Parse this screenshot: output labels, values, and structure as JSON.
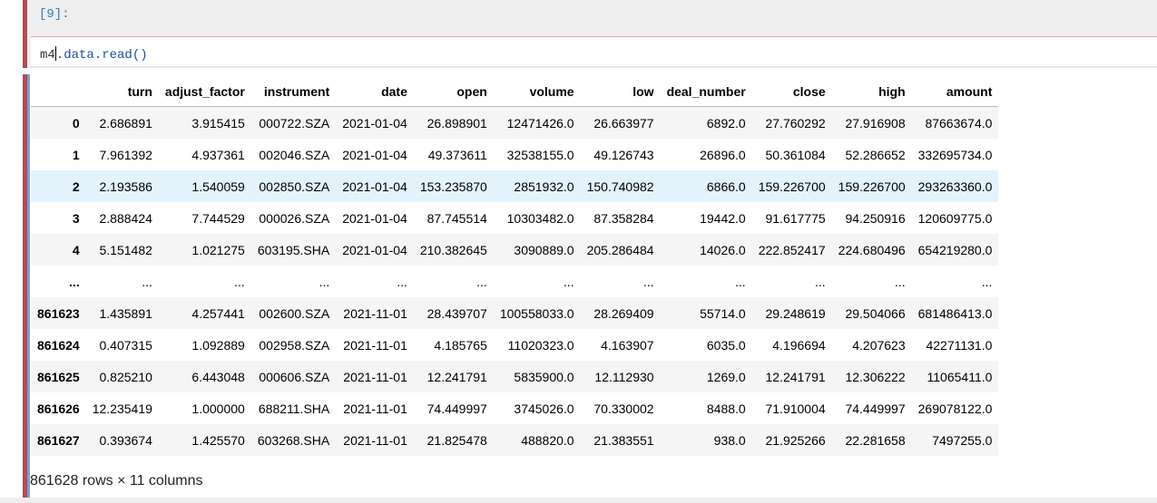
{
  "input_cell": {
    "prompt": "[9]:",
    "code_obj": "m4",
    "code_rest": ".data.read()"
  },
  "output": {
    "columns": [
      "turn",
      "adjust_factor",
      "instrument",
      "date",
      "open",
      "volume",
      "low",
      "deal_number",
      "close",
      "high",
      "amount"
    ],
    "rows": [
      {
        "index": "0",
        "cells": [
          "2.686891",
          "3.915415",
          "000722.SZA",
          "2021-01-04",
          "26.898901",
          "12471426.0",
          "26.663977",
          "6892.0",
          "27.760292",
          "27.916908",
          "87663674.0"
        ]
      },
      {
        "index": "1",
        "cells": [
          "7.961392",
          "4.937361",
          "002046.SZA",
          "2021-01-04",
          "49.373611",
          "32538155.0",
          "49.126743",
          "26896.0",
          "50.361084",
          "52.286652",
          "332695734.0"
        ]
      },
      {
        "index": "2",
        "cells": [
          "2.193586",
          "1.540059",
          "002850.SZA",
          "2021-01-04",
          "153.235870",
          "2851932.0",
          "150.740982",
          "6866.0",
          "159.226700",
          "159.226700",
          "293263360.0"
        ]
      },
      {
        "index": "3",
        "cells": [
          "2.888424",
          "7.744529",
          "000026.SZA",
          "2021-01-04",
          "87.745514",
          "10303482.0",
          "87.358284",
          "19442.0",
          "91.617775",
          "94.250916",
          "120609775.0"
        ]
      },
      {
        "index": "4",
        "cells": [
          "5.151482",
          "1.021275",
          "603195.SHA",
          "2021-01-04",
          "210.382645",
          "3090889.0",
          "205.286484",
          "14026.0",
          "222.852417",
          "224.680496",
          "654219280.0"
        ]
      },
      {
        "index": "...",
        "cells": [
          "...",
          "...",
          "...",
          "...",
          "...",
          "...",
          "...",
          "...",
          "...",
          "...",
          "..."
        ]
      },
      {
        "index": "861623",
        "cells": [
          "1.435891",
          "4.257441",
          "002600.SZA",
          "2021-11-01",
          "28.439707",
          "100558033.0",
          "28.269409",
          "55714.0",
          "29.248619",
          "29.504066",
          "681486413.0"
        ]
      },
      {
        "index": "861624",
        "cells": [
          "0.407315",
          "1.092889",
          "002958.SZA",
          "2021-11-01",
          "4.185765",
          "11020323.0",
          "4.163907",
          "6035.0",
          "4.196694",
          "4.207623",
          "42271131.0"
        ]
      },
      {
        "index": "861625",
        "cells": [
          "0.825210",
          "6.443048",
          "000606.SZA",
          "2021-11-01",
          "12.241791",
          "5835900.0",
          "12.112930",
          "1269.0",
          "12.241791",
          "12.306222",
          "11065411.0"
        ]
      },
      {
        "index": "861626",
        "cells": [
          "12.235419",
          "1.000000",
          "688211.SHA",
          "2021-11-01",
          "74.449997",
          "3745026.0",
          "70.330002",
          "8488.0",
          "71.910004",
          "74.449997",
          "269078122.0"
        ]
      },
      {
        "index": "861627",
        "cells": [
          "0.393674",
          "1.425570",
          "603268.SHA",
          "2021-11-01",
          "21.825478",
          "488820.0",
          "21.383551",
          "938.0",
          "21.925266",
          "22.281658",
          "7497255.0"
        ]
      }
    ],
    "highlighted_row": "2",
    "summary": "861628 rows × 11 columns"
  },
  "colors": {
    "selected_cell_bar": "#b34b53",
    "row_hover": "#e3f2fb",
    "prompt": "#307fc1"
  }
}
